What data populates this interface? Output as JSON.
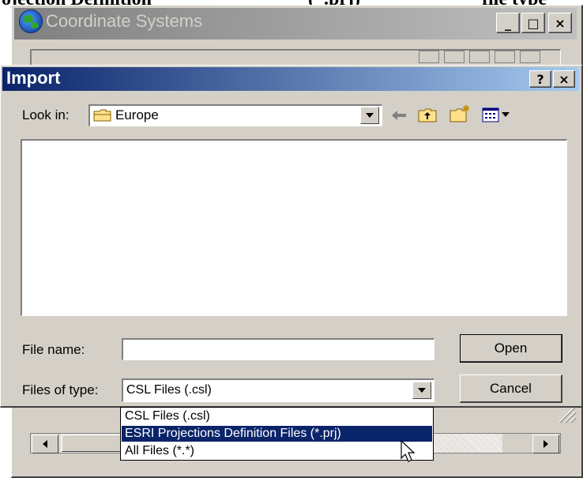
{
  "document": {
    "text_left": "ojection Definition",
    "text_mid": "(*.prj)",
    "text_right": "file type"
  },
  "background_window": {
    "title": "Coordinate Systems",
    "icon": "globe-icon",
    "minimize_label": "_",
    "maximize_label": "□",
    "close_label": "×"
  },
  "import_dialog": {
    "title": "Import",
    "help_label": "?",
    "close_label": "×",
    "look_in_label": "Look in:",
    "look_in_value": "Europe",
    "file_name_label": "File name:",
    "file_name_value": "",
    "files_of_type_label": "Files of type:",
    "files_of_type_value": "CSL Files (.csl)",
    "open_label": "Open",
    "cancel_label": "Cancel",
    "file_type_options": [
      "CSL Files (.csl)",
      "ESRI Projections Definition Files (*.prj)",
      "All Files (*.*)"
    ],
    "highlighted_option": "ESRI Projections Definition Files (*.prj)"
  },
  "colors": {
    "title_active": "#0a246a",
    "title_inactive": "#808080",
    "face": "#d4d0c8",
    "selection": "#0a246a"
  }
}
